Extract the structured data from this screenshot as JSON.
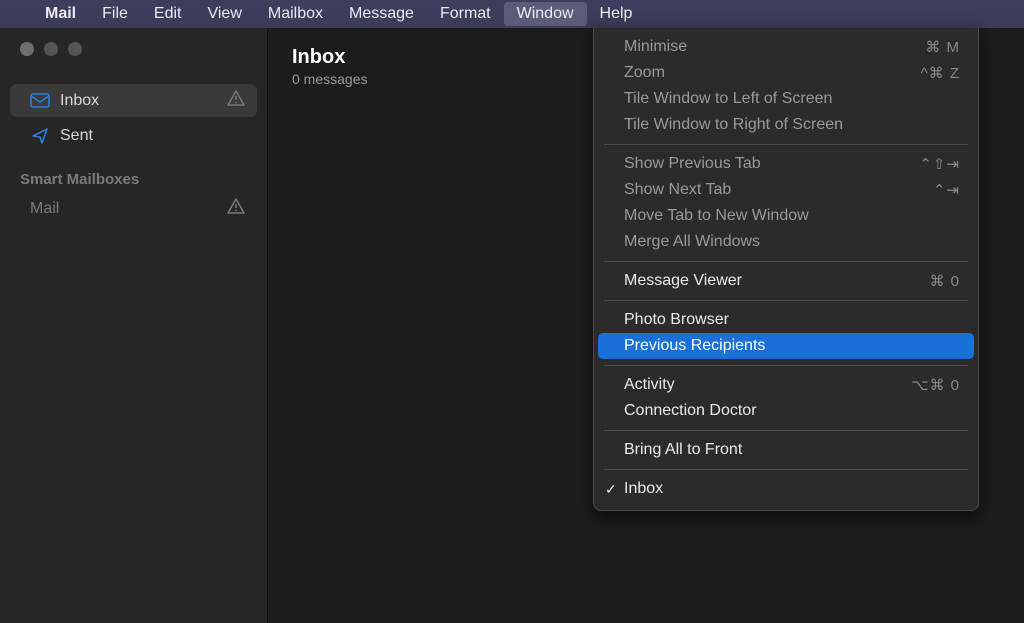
{
  "menubar": {
    "items": [
      {
        "label": "Mail",
        "bold": true
      },
      {
        "label": "File"
      },
      {
        "label": "Edit"
      },
      {
        "label": "View"
      },
      {
        "label": "Mailbox"
      },
      {
        "label": "Message"
      },
      {
        "label": "Format"
      },
      {
        "label": "Window",
        "active": true
      },
      {
        "label": "Help"
      }
    ]
  },
  "sidebar": {
    "inbox_label": "Inbox",
    "sent_label": "Sent",
    "smart_label": "Smart Mailboxes",
    "mail_label": "Mail"
  },
  "main": {
    "title": "Inbox",
    "subtitle": "0 messages"
  },
  "window_menu": {
    "minimise": {
      "label": "Minimise",
      "shortcut": "⌘ M"
    },
    "zoom": {
      "label": "Zoom",
      "shortcut": "^⌘ Z"
    },
    "tile_left": {
      "label": "Tile Window to Left of Screen"
    },
    "tile_right": {
      "label": "Tile Window to Right of Screen"
    },
    "show_prev_tab": {
      "label": "Show Previous Tab",
      "shortcut": "⌃⇧⇥"
    },
    "show_next_tab": {
      "label": "Show Next Tab",
      "shortcut": "⌃⇥"
    },
    "move_tab": {
      "label": "Move Tab to New Window"
    },
    "merge_windows": {
      "label": "Merge All Windows"
    },
    "message_viewer": {
      "label": "Message Viewer",
      "shortcut": "⌘ 0"
    },
    "photo_browser": {
      "label": "Photo Browser"
    },
    "previous_recipients": {
      "label": "Previous Recipients"
    },
    "activity": {
      "label": "Activity",
      "shortcut": "⌥⌘ 0"
    },
    "connection_doctor": {
      "label": "Connection Doctor"
    },
    "bring_to_front": {
      "label": "Bring All to Front"
    },
    "inbox_window": {
      "label": "Inbox"
    }
  }
}
